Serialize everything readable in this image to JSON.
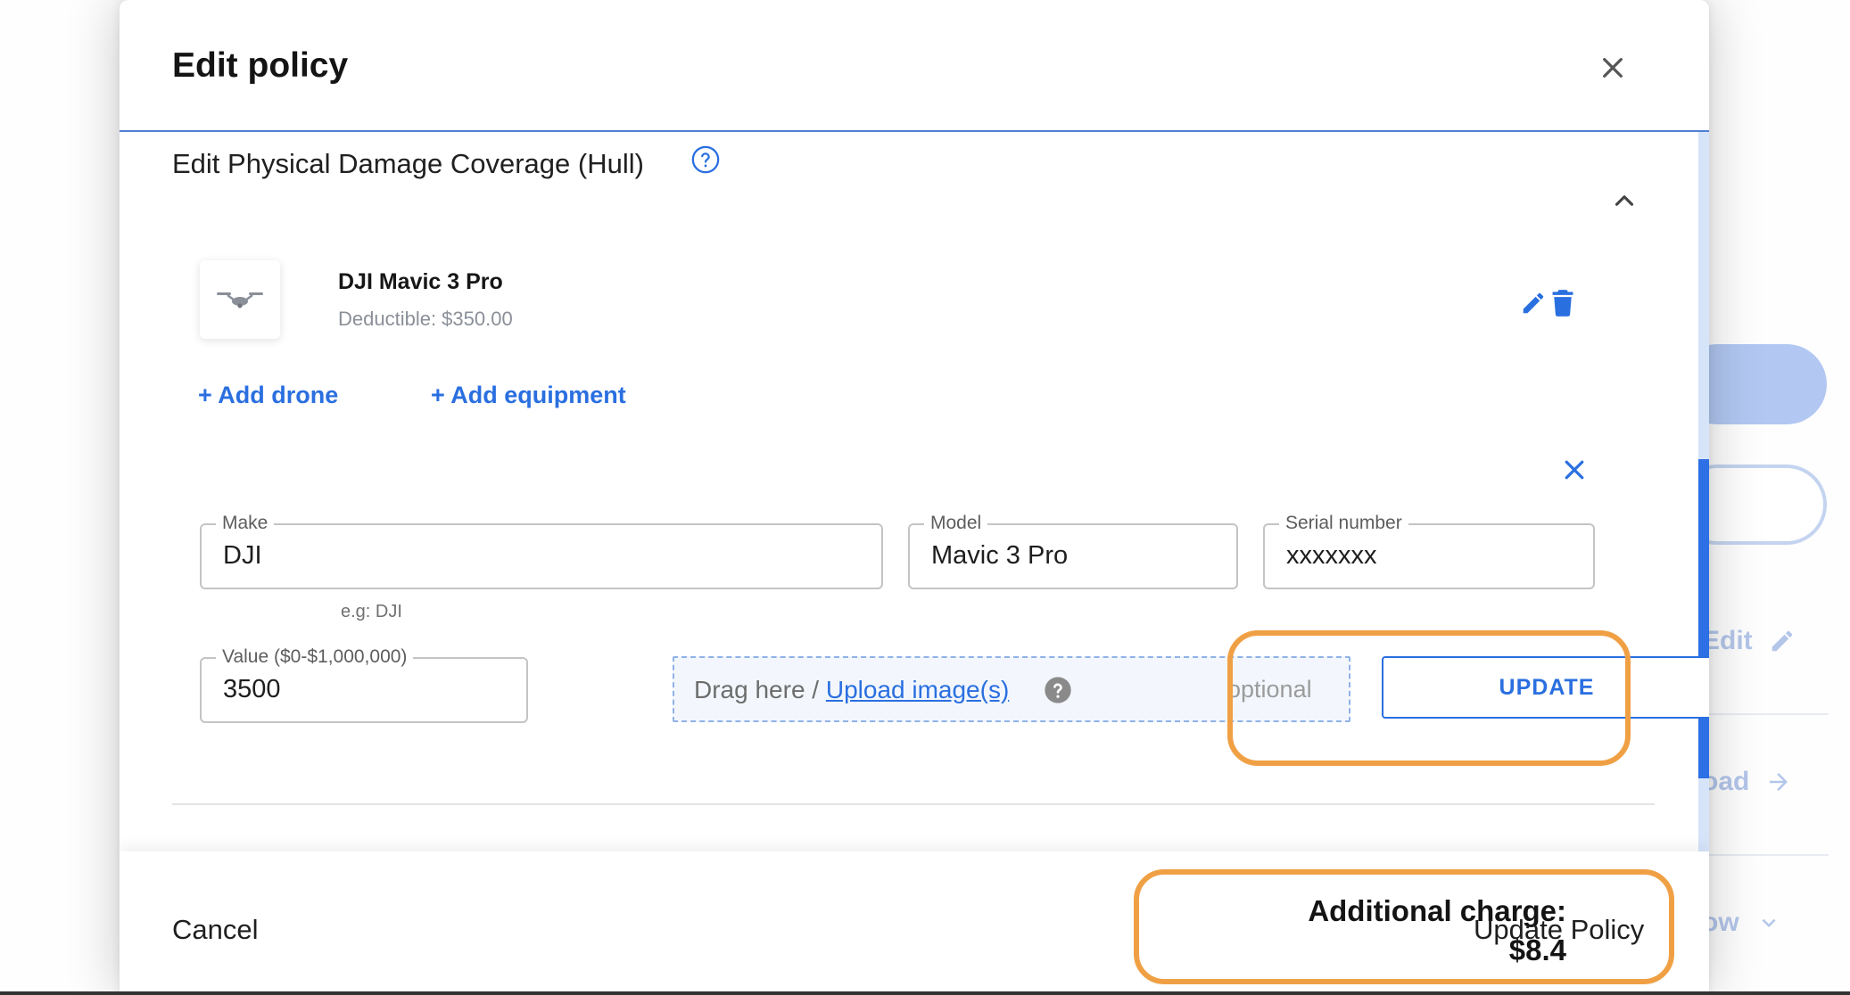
{
  "modal": {
    "title": "Edit policy",
    "section_title": "Edit Physical Damage Coverage (Hull)"
  },
  "drone": {
    "name": "DJI Mavic 3 Pro",
    "deductible": "Deductible: $350.00"
  },
  "actions": {
    "add_drone": "+ Add drone",
    "add_equipment": "+ Add equipment"
  },
  "form": {
    "make": {
      "label": "Make",
      "value": "DJI",
      "helper": "e.g: DJI"
    },
    "model": {
      "label": "Model",
      "value": "Mavic 3 Pro"
    },
    "serial": {
      "label": "Serial number",
      "value": "xxxxxxx"
    },
    "value": {
      "label": "Value ($0-$1,000,000)",
      "value": "3500"
    },
    "upload": {
      "prefix": "Drag here / ",
      "link": "Upload image(s)",
      "optional": "optional"
    },
    "update_button": "UPDATE"
  },
  "footer": {
    "cancel": "Cancel",
    "charge_label": "Additional charge:",
    "charge_value": "$8.4",
    "update_policy": "Update Policy"
  },
  "background": {
    "edit_link": "Edit",
    "upload_link": "oad",
    "show_link": "ow"
  },
  "colors": {
    "accent": "#2a6fe0",
    "annotation": "#f0a044",
    "header_rule": "#4f7fd4"
  }
}
